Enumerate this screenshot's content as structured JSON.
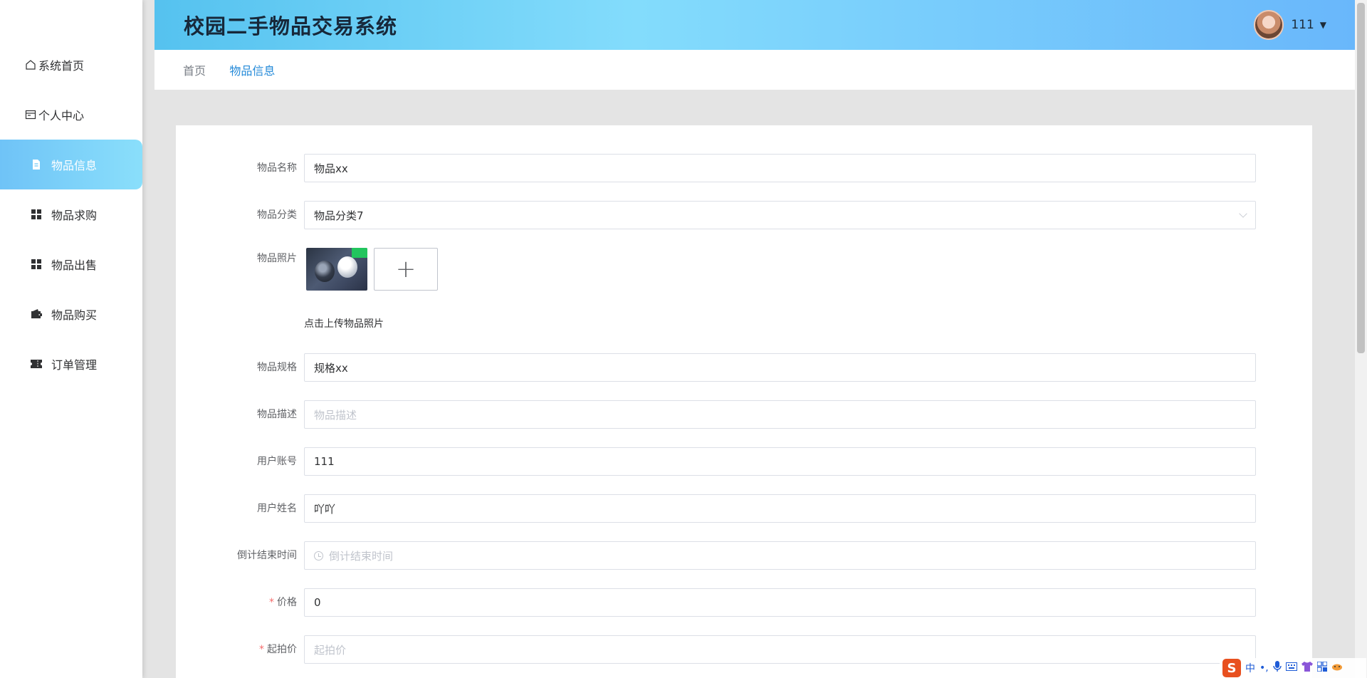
{
  "app": {
    "title": "校园二手物品交易系统"
  },
  "user": {
    "name": "111"
  },
  "sidebar": {
    "items": [
      {
        "label": "系统首页",
        "icon": "home-icon"
      },
      {
        "label": "个人中心",
        "icon": "profile-card-icon"
      },
      {
        "label": "物品信息",
        "icon": "document-icon",
        "active": true
      },
      {
        "label": "物品求购",
        "icon": "grid-icon"
      },
      {
        "label": "物品出售",
        "icon": "grid-icon"
      },
      {
        "label": "物品购买",
        "icon": "wallet-icon"
      },
      {
        "label": "订单管理",
        "icon": "ticket-icon"
      }
    ]
  },
  "breadcrumb": {
    "home": "首页",
    "current": "物品信息"
  },
  "form": {
    "name": {
      "label": "物品名称",
      "value": "物品xx"
    },
    "category": {
      "label": "物品分类",
      "value": "物品分类7"
    },
    "photo": {
      "label": "物品照片",
      "upload_symbol": "+",
      "hint": "点击上传物品照片"
    },
    "spec": {
      "label": "物品规格",
      "value": "规格xx"
    },
    "description": {
      "label": "物品描述",
      "placeholder": "物品描述"
    },
    "account": {
      "label": "用户账号",
      "value": "111"
    },
    "username": {
      "label": "用户姓名",
      "value": "吖吖"
    },
    "countdown": {
      "label": "倒计结束时间",
      "placeholder": "倒计结束时间"
    },
    "price": {
      "label": "价格",
      "value": "0",
      "required": "*"
    },
    "start_price": {
      "label": "起拍价",
      "placeholder": "起拍价",
      "required": "*"
    }
  },
  "ime": {
    "logo": "S",
    "lang": "中",
    "punct": "•,"
  },
  "colors": {
    "header_start": "#55c2ef",
    "header_end": "#69b7fb",
    "active_menu": "#6fc3f7",
    "link": "#2389d8",
    "required": "#f56c6c"
  }
}
